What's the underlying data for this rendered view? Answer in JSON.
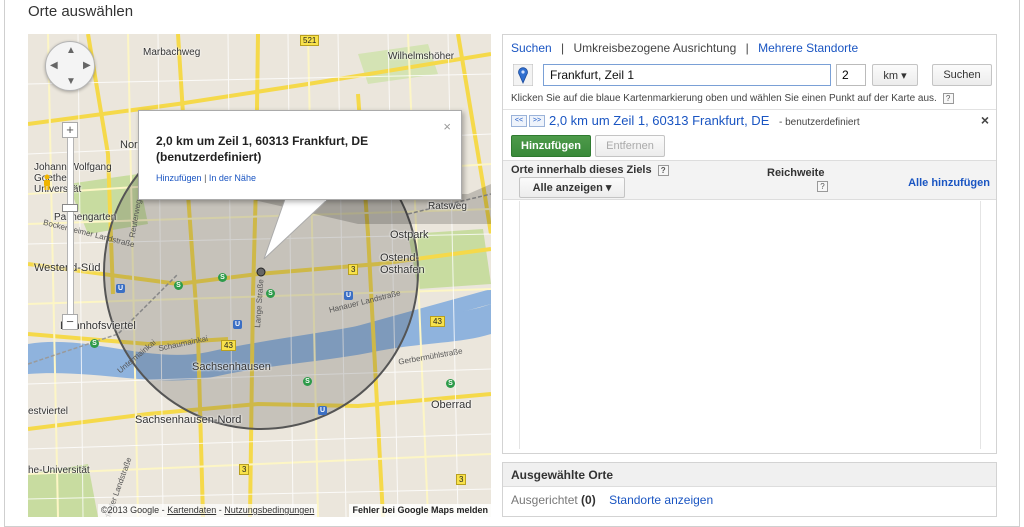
{
  "page": {
    "title": "Orte auswählen"
  },
  "map": {
    "places": [
      "Marbachweg",
      "Wilhelmshöher",
      "Nord",
      "Johann Wolfgang Goethe-Universität",
      "Palmengarten",
      "Westend-Süd",
      "Bahnhofsviertel",
      "Sachsenhausen",
      "Sachsenhausen-Nord",
      "Ostpark",
      "Ostend-Osthafen",
      "Oberrad",
      "Ratsweg",
      "estviertel",
      "he-Universität"
    ],
    "roads": [
      "Bockenheimer Landstraße",
      "Reuterweg",
      "Lange Straße",
      "Hanauer Landstraße",
      "Schaumainkai",
      "Untermainkai",
      "Gerbermühlstraße",
      "Mörfelder Landstraße"
    ],
    "shields": [
      "521",
      "3",
      "43",
      "3",
      "43",
      "3"
    ],
    "controls": {
      "zoom_in": "+",
      "zoom_out": "−"
    },
    "infowindow": {
      "title_line1": "2,0 km um Zeil 1, 60313 Frankfurt, DE",
      "title_line2": "(benutzerdefiniert)",
      "link_add": "Hinzufügen",
      "link_separator": "|",
      "link_nearby": "In der Nähe",
      "close": "×"
    },
    "footer": {
      "copyright": "©2013 Google - ",
      "map_data": "Kartendaten",
      "dash": " - ",
      "terms": "Nutzungsbedingungen",
      "report": "Fehler bei Google Maps melden"
    }
  },
  "panel": {
    "tabs": {
      "search": "Suchen",
      "separator": "|",
      "radius": "Umkreisbezogene Ausrichtung",
      "multiple": "Mehrere Standorte"
    },
    "location_input": "Frankfurt, Zeil 1",
    "radius_value": "2",
    "unit": "km ▾",
    "search_button": "Suchen",
    "hint": "Klicken Sie auf die blaue Kartenmarkierung oben und wählen Sie einen Punkt auf der Karte aus.",
    "help": "?",
    "nav_prev": "<<",
    "nav_next": ">>",
    "selected_location": "2,0 km um Zeil 1, 60313 Frankfurt, DE",
    "selected_tag": "- benutzerdefiniert",
    "close": "×",
    "add_button": "Hinzufügen",
    "remove_button": "Entfernen",
    "table": {
      "col_places": "Orte innerhalb dieses Ziels",
      "col_reach": "Reichweite",
      "show_all": "Alle anzeigen ▾",
      "add_all": "Alle hinzufügen"
    }
  },
  "selected": {
    "title": "Ausgewählte Orte",
    "targeted_label": "Ausgerichtet",
    "targeted_count": "(0)",
    "show_locations": "Standorte anzeigen"
  },
  "colors": {
    "link": "#1a55c2",
    "add_button": "#3a8a3a",
    "map_road_major": "#f8e24b",
    "map_water": "#7fa8d6",
    "map_park": "#b9d48b"
  }
}
